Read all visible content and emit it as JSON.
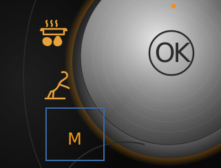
{
  "control_panel": {
    "dial": {
      "ok_label": "OK"
    },
    "modes": [
      {
        "name": "steam",
        "icon": "steam-pot-icon"
      },
      {
        "name": "roast",
        "icon": "roast-chicken-icon"
      },
      {
        "name": "manual",
        "label": "M",
        "selected": true
      }
    ]
  },
  "colors": {
    "glow": "#f39a1c",
    "icon": "#e7a23a",
    "selection_border": "#3a6aa6",
    "dial_metal": "#b9b9b9"
  }
}
